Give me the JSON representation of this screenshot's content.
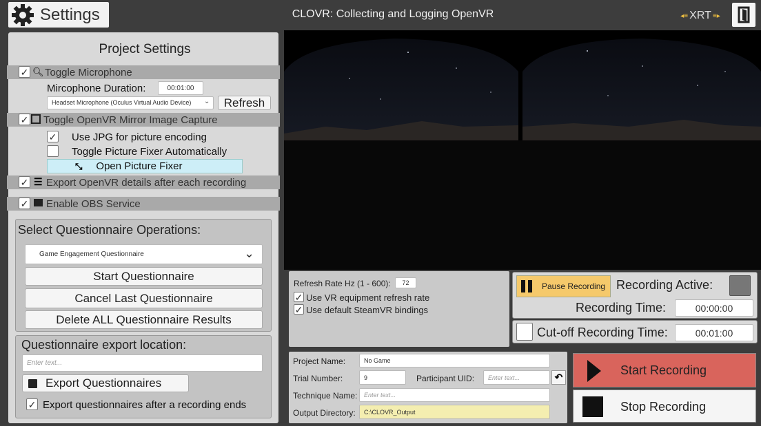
{
  "header": {
    "settings_label": "Settings",
    "app_title": "CLOVR: Collecting and Logging OpenVR",
    "logo_text": "XRT"
  },
  "project_settings": {
    "title": "Project Settings",
    "toggle_microphone": "Toggle Microphone",
    "mic_duration_label": "Mircophone Duration:",
    "mic_duration_value": "00:01:00",
    "mic_device": "Headset Microphone (Oculus Virtual Audio Device)",
    "refresh_label": "Refresh",
    "toggle_mirror": "Toggle OpenVR Mirror Image Capture",
    "use_jpg": "Use JPG for picture encoding",
    "toggle_fixer": "Toggle Picture Fixer Automatically",
    "open_fixer": "Open Picture Fixer",
    "export_details": "Export OpenVR details after each recording",
    "enable_obs": "Enable OBS Service"
  },
  "questionnaire": {
    "ops_title": "Select Questionnaire Operations:",
    "selected": "Game Engagement Questionnaire",
    "start": "Start Questionnaire",
    "cancel_last": "Cancel Last Questionnaire",
    "delete_all": "Delete ALL Questionnaire Results",
    "export_title": "Questionnaire export location:",
    "export_placeholder": "Enter text...",
    "export_button": "Export Questionnaires",
    "export_after": "Export questionnaires after a recording ends"
  },
  "controls": {
    "refresh_rate_label": "Refresh Rate Hz (1 - 600):",
    "refresh_rate_value": "72",
    "use_vr_rate": "Use VR equipment refresh rate",
    "use_default_bindings": "Use default SteamVR bindings"
  },
  "recording": {
    "pause_label": "Pause Recording",
    "active_label": "Recording Active:",
    "time_label": "Recording Time:",
    "time_value": "00:00:00",
    "cutoff_label": "Cut-off Recording Time:",
    "cutoff_value": "00:01:00",
    "start_label": "Start Recording",
    "stop_label": "Stop Recording"
  },
  "project": {
    "name_label": "Project Name:",
    "name_value": "No Game",
    "trial_label": "Trial Number:",
    "trial_value": "9",
    "participant_label": "Participant UID:",
    "participant_placeholder": "Enter text...",
    "technique_label": "Technique Name:",
    "technique_placeholder": "Enter text...",
    "output_label": "Output Directory:",
    "output_value": "C:\\CLOVR_Output"
  },
  "colors": {
    "start_recording": "#d9645c",
    "pause_button": "#f5c96b",
    "fixer_button": "#cdeef7",
    "output_field": "#f4eeb0"
  },
  "icons": [
    "gear-icon",
    "exit-door-icon",
    "search-icon",
    "film-icon",
    "collapse-arrows-icon",
    "list-icon",
    "clapperboard-icon",
    "chevron-down-icon",
    "save-icon",
    "reset-icon",
    "pause-icon",
    "play-icon",
    "stop-icon"
  ]
}
